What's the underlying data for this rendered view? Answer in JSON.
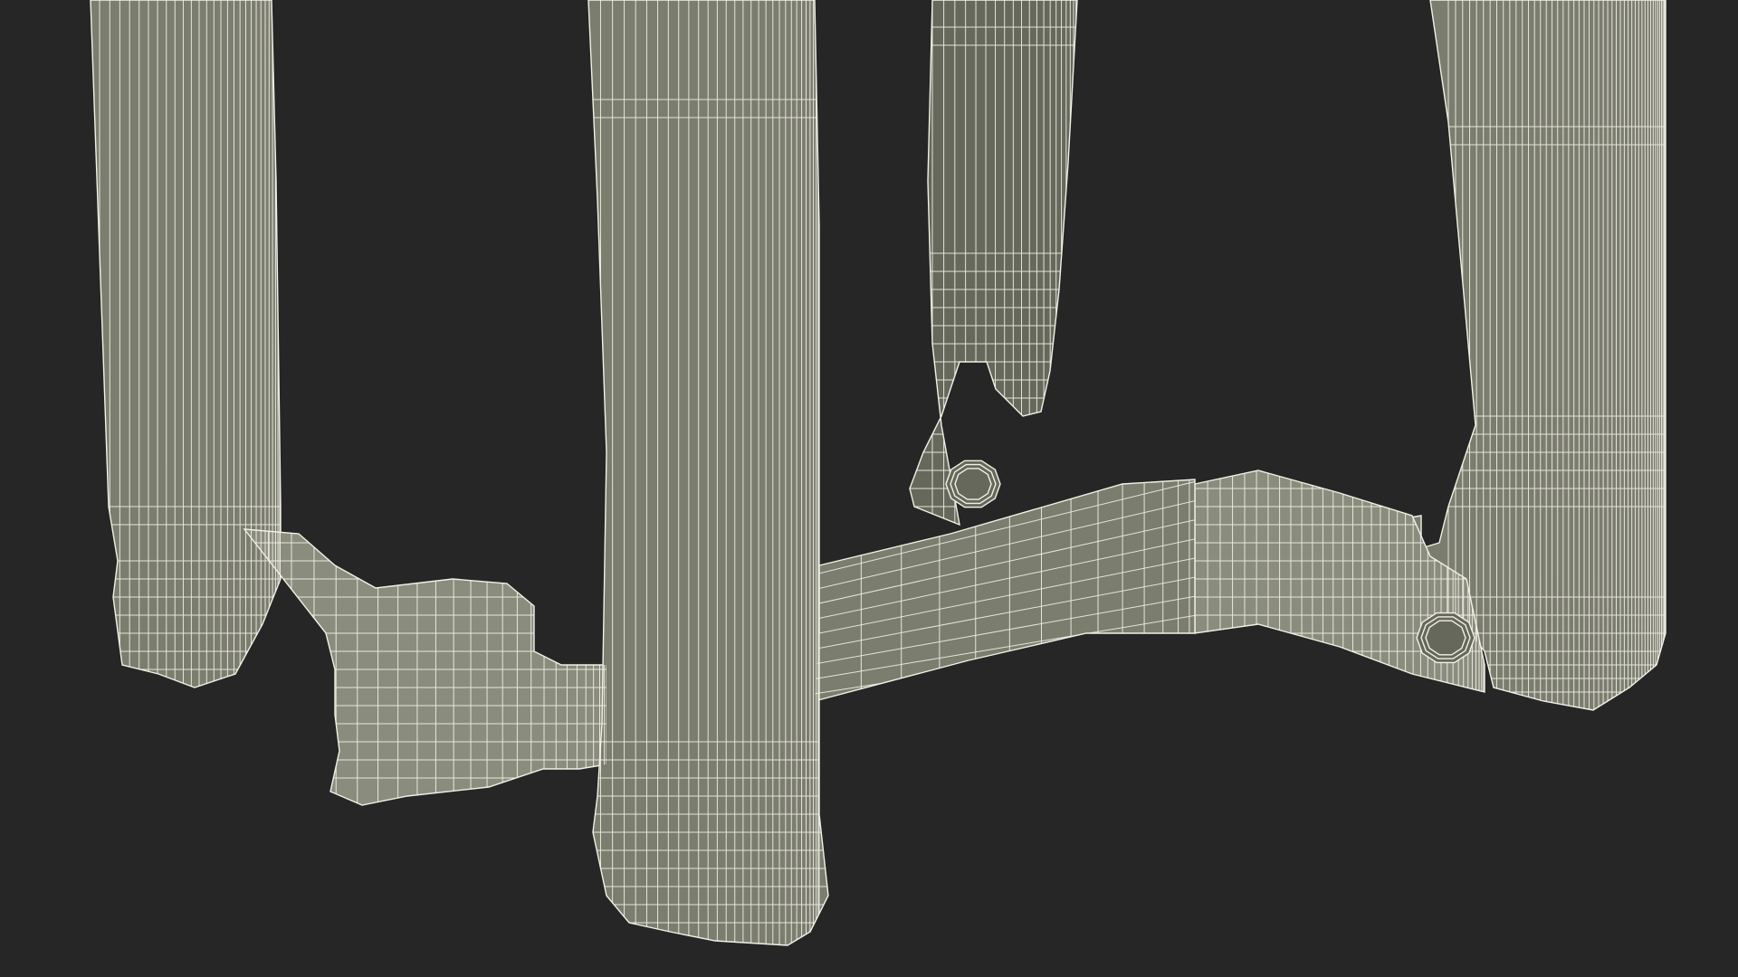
{
  "scene": {
    "subject": "wireframe-stool-legs",
    "background_color": "#262626",
    "surface_color": "#7b7d6f",
    "surface_light_color": "#8a8c7e",
    "surface_dark_color": "#66685b",
    "wire_color": "#f2f1e6"
  }
}
